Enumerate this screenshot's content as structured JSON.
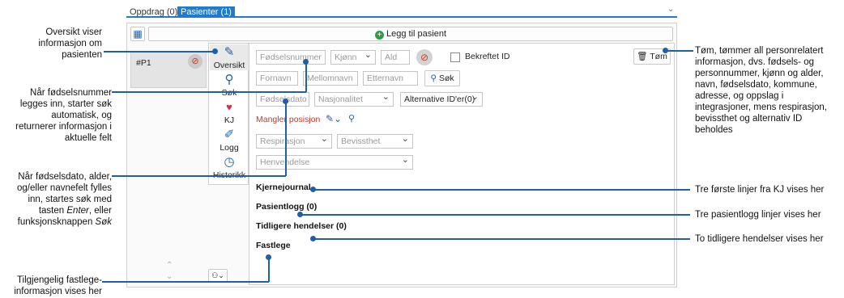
{
  "tabs": [
    {
      "label": "Oppdrag (0)"
    },
    {
      "label": "Pasienter (1)"
    }
  ],
  "toolbar": {
    "add_patient_label": "Legg til pasient"
  },
  "patient": {
    "id": "#P1"
  },
  "side_nav": [
    {
      "label": "Oversikt",
      "icon": "pencil-icon"
    },
    {
      "label": "Søk",
      "icon": "magnifier-icon"
    },
    {
      "label": "KJ",
      "icon": "heart-doc-icon"
    },
    {
      "label": "Logg",
      "icon": "edit-doc-icon"
    },
    {
      "label": "Historikk",
      "icon": "clock-icon"
    }
  ],
  "form": {
    "fodselsnummer_placeholder": "Fødselsnummer",
    "kjonn_placeholder": "Kjønn",
    "alder_placeholder": "Ald",
    "bekreftet_id_label": "Bekreftet ID",
    "tom_label": "Tøm",
    "fornavn_placeholder": "Fornavn",
    "mellomnavn_placeholder": "Mellomnavn",
    "etternavn_placeholder": "Etternavn",
    "sok_label": "Søk",
    "fodselsdato_placeholder": "Fødselsdato",
    "nasjonalitet_placeholder": "Nasjonalitet",
    "alternative_id_label": "Alternative ID'er(0)",
    "mangler_posisjon_label": "Mangler posisjon",
    "respirasjon_placeholder": "Respirasjon",
    "bevissthet_placeholder": "Bevissthet",
    "henvendelse_placeholder": "Henvendelse"
  },
  "sections": {
    "kjernejournal": "Kjernejournal",
    "pasientlogg": "Pasientlogg (0)",
    "tidligere": "Tidligere hendelser (0)",
    "fastlege": "Fastlege"
  },
  "callouts": {
    "oversikt": [
      "Oversikt viser",
      "informasjon om",
      "pasienten"
    ],
    "fodselsnummer": [
      "Når fødselsnummer",
      "legges inn, starter søk",
      "automatisk, og",
      "returnerer informasjon i",
      "aktuelle felt"
    ],
    "fodselsdato_line1": "Når fødselsdato, alder,",
    "fodselsdato_line2": "og/eller navnefelt fylles",
    "fodselsdato_line3": "inn, startes søk med",
    "fodselsdato_line4_a": "tasten ",
    "fodselsdato_line4_em": "Enter",
    "fodselsdato_line4_b": ", eller",
    "fodselsdato_line5_a": "funksjonsknappen ",
    "fodselsdato_line5_em": "Søk",
    "fastlege": [
      "Tilgjengelig fastlege-",
      "informasjon vises her"
    ],
    "tom": [
      "Tøm, tømmer all personrelatert",
      "informasjon, dvs. fødsels- og",
      "personnummer, kjønn og alder,",
      "navn, fødselsdato, kommune,",
      "adresse,  og oppslag i",
      "integrasjoner, mens respirasjon,",
      "bevissthet og alternativ ID",
      "beholdes"
    ],
    "kj": "Tre første linjer fra KJ vises her",
    "pasientlogg": "Tre pasientlogg linjer vises her",
    "hendelser": "To tidligere hendelser vises her"
  }
}
